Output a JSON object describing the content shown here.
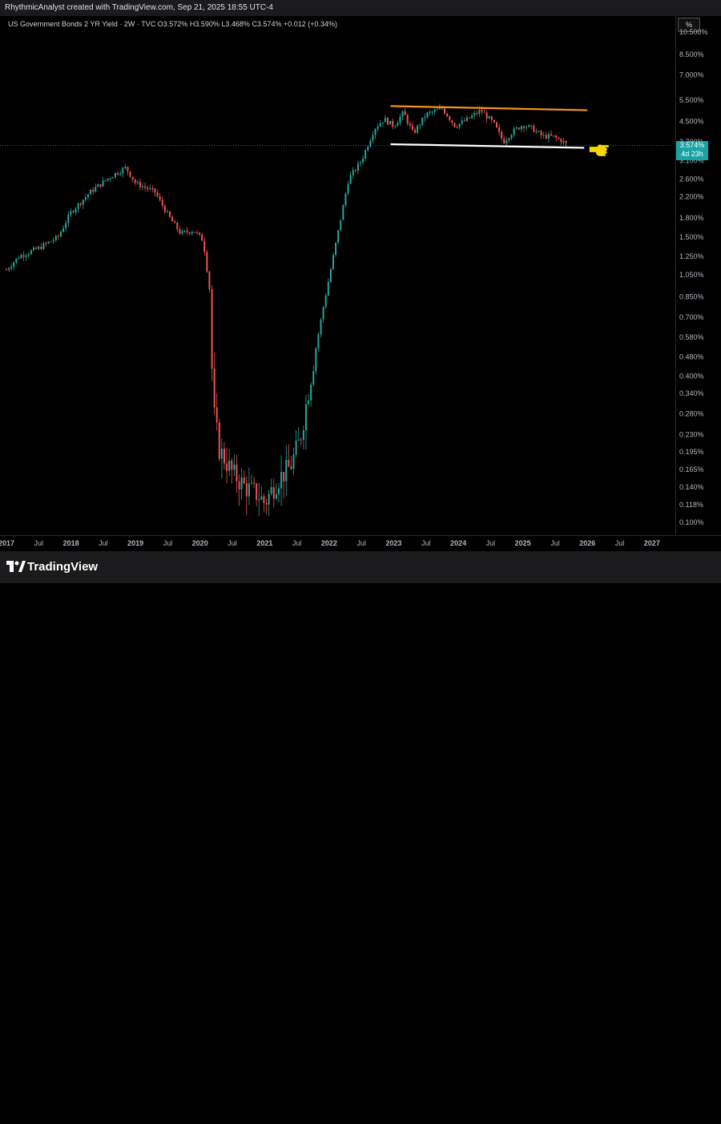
{
  "header": {
    "attribution": "RhythmicAnalyst created with TradingView.com, Sep 21, 2025 18:55 UTC-4"
  },
  "legend": {
    "symbol": "US Government Bonds 2 YR Yield · 2W · TVC",
    "o_label": "O",
    "o_value": "3.572%",
    "h_label": "H",
    "h_value": "3.590%",
    "l_label": "L",
    "l_value": "3.468%",
    "c_label": "C",
    "c_value": "3.574%",
    "change": "+0.012 (+0.34%)"
  },
  "axis": {
    "unit": "%",
    "price_label": "3.574%",
    "countdown": "4d 23h"
  },
  "footer": {
    "brand": "TradingView"
  },
  "colors": {
    "up": "#26a69a",
    "down": "#ef5350",
    "resistance": "#f7931a",
    "support": "#ffffff",
    "hand": "#f5d800",
    "price_badge": "#1aa3a3"
  },
  "chart_data": {
    "type": "candlestick",
    "title": "US Government Bonds 2 YR Yield · 2W · TVC",
    "scale": "log",
    "ylim": [
      0.1,
      10.5
    ],
    "y_ticks": [
      "10.500%",
      "8.500%",
      "7.000%",
      "5.500%",
      "4.500%",
      "3.700%",
      "3.100%",
      "2.600%",
      "2.200%",
      "1.800%",
      "1.500%",
      "1.250%",
      "1.050%",
      "0.850%",
      "0.700%",
      "0.580%",
      "0.480%",
      "0.400%",
      "0.340%",
      "0.280%",
      "0.230%",
      "0.195%",
      "0.165%",
      "0.140%",
      "0.118%",
      "0.100%"
    ],
    "y_tick_values": [
      10.5,
      8.5,
      7.0,
      5.5,
      4.5,
      3.7,
      3.1,
      2.6,
      2.2,
      1.8,
      1.5,
      1.25,
      1.05,
      0.85,
      0.7,
      0.58,
      0.48,
      0.4,
      0.34,
      0.28,
      0.23,
      0.195,
      0.165,
      0.14,
      0.118,
      0.1
    ],
    "x_ticks": [
      "2017",
      "Jul",
      "2018",
      "Jul",
      "2019",
      "Jul",
      "2020",
      "Jul",
      "2021",
      "Jul",
      "2022",
      "Jul",
      "2023",
      "Jul",
      "2024",
      "Jul",
      "2025",
      "Jul",
      "2026",
      "Jul",
      "2027"
    ],
    "x_tick_dates": [
      2017.0,
      2017.5,
      2018.0,
      2018.5,
      2019.0,
      2019.5,
      2020.0,
      2020.5,
      2021.0,
      2021.5,
      2022.0,
      2022.5,
      2023.0,
      2023.5,
      2024.0,
      2024.5,
      2025.0,
      2025.5,
      2026.0,
      2026.5,
      2027.0
    ],
    "xlim": [
      2017.0,
      2027.3
    ],
    "series_path": [
      [
        2017.0,
        1.1
      ],
      [
        2017.2,
        1.25
      ],
      [
        2017.5,
        1.35
      ],
      [
        2017.8,
        1.5
      ],
      [
        2018.0,
        1.9
      ],
      [
        2018.3,
        2.3
      ],
      [
        2018.6,
        2.65
      ],
      [
        2018.85,
        2.9
      ],
      [
        2019.0,
        2.5
      ],
      [
        2019.3,
        2.3
      ],
      [
        2019.5,
        1.85
      ],
      [
        2019.7,
        1.55
      ],
      [
        2019.9,
        1.6
      ],
      [
        2020.05,
        1.45
      ],
      [
        2020.15,
        0.9
      ],
      [
        2020.2,
        0.3
      ],
      [
        2020.3,
        0.2
      ],
      [
        2020.5,
        0.16
      ],
      [
        2020.7,
        0.14
      ],
      [
        2020.9,
        0.13
      ],
      [
        2021.0,
        0.12
      ],
      [
        2021.2,
        0.15
      ],
      [
        2021.4,
        0.17
      ],
      [
        2021.55,
        0.22
      ],
      [
        2021.75,
        0.45
      ],
      [
        2021.9,
        0.75
      ],
      [
        2022.1,
        1.4
      ],
      [
        2022.3,
        2.6
      ],
      [
        2022.5,
        3.1
      ],
      [
        2022.7,
        4.2
      ],
      [
        2022.85,
        4.6
      ],
      [
        2023.0,
        4.3
      ],
      [
        2023.15,
        4.9
      ],
      [
        2023.3,
        4.0
      ],
      [
        2023.5,
        4.8
      ],
      [
        2023.75,
        5.1
      ],
      [
        2023.95,
        4.3
      ],
      [
        2024.15,
        4.6
      ],
      [
        2024.35,
        5.0
      ],
      [
        2024.55,
        4.4
      ],
      [
        2024.7,
        3.7
      ],
      [
        2024.85,
        4.1
      ],
      [
        2025.0,
        4.35
      ],
      [
        2025.15,
        4.2
      ],
      [
        2025.3,
        3.9
      ],
      [
        2025.45,
        3.9
      ],
      [
        2025.6,
        3.75
      ],
      [
        2025.7,
        3.57
      ]
    ],
    "trendlines": [
      {
        "name": "resistance",
        "from": [
          2022.95,
          5.2
        ],
        "to": [
          2026.0,
          5.0
        ]
      },
      {
        "name": "support",
        "from": [
          2022.95,
          3.62
        ],
        "to": [
          2025.95,
          3.5
        ]
      }
    ],
    "last": {
      "date": 2025.7,
      "value": 3.574
    }
  }
}
